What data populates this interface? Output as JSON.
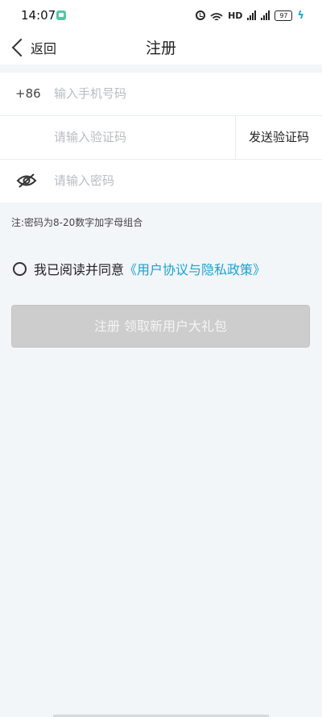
{
  "status_bar": {
    "time": "14:07",
    "network_label": "HD",
    "battery_level": "97",
    "icons": [
      "app-notification-icon",
      "alarm-icon",
      "wifi-icon",
      "signal-4g-icon",
      "signal-4g-icon",
      "battery-icon",
      "charging-bolt-icon"
    ],
    "colors": {
      "app_icon": "#4fc9a4",
      "bolt": "#19a7d6"
    }
  },
  "nav": {
    "back_label": "返回",
    "title": "注册"
  },
  "form": {
    "phone_prefix": "+86",
    "phone_placeholder": "输入手机号码",
    "code_placeholder": "请输入验证码",
    "send_code_label": "发送验证码",
    "password_placeholder": "请输入密码",
    "password_visibility_icon": "eye-off-icon"
  },
  "note": "注:密码为8-20数字加字母组合",
  "agreement": {
    "text": "我已阅读并同意",
    "link": "《用户协议与隐私政策》",
    "link_color": "#1aa3d0",
    "checked": false
  },
  "register_button_label": "注册 领取新用户大礼包"
}
